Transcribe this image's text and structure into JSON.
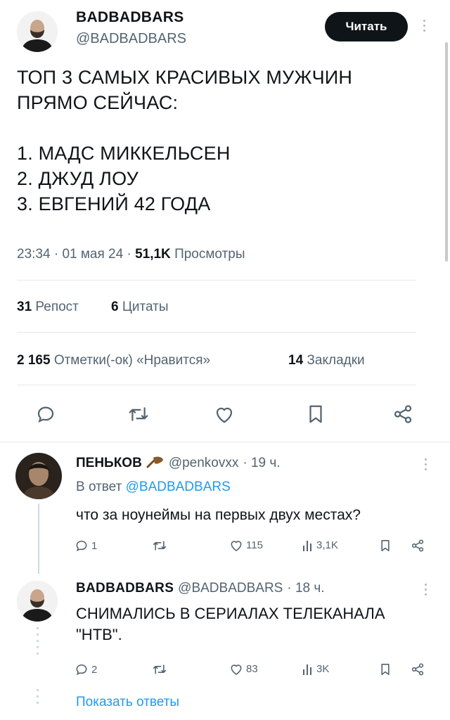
{
  "main_tweet": {
    "author_name": "BADBADBARS",
    "author_handle": "@BADBADBARS",
    "follow_label": "Читать",
    "text": "ТОП 3 САМЫХ КРАСИВЫХ МУЖЧИН\nПРЯМО СЕЙЧАС:\n\n1. МАДС МИККЕЛЬСЕН\n2. ДЖУД ЛОУ\n3. ЕВГЕНИЙ 42 ГОДА",
    "time": "23:34",
    "sep": "·",
    "date": "01 мая 24",
    "views_count": "51,1K",
    "views_label": "Просмотры",
    "reposts_count": "31",
    "reposts_label": "Репост",
    "quotes_count": "6",
    "quotes_label": "Цитаты",
    "likes_count": "2 165",
    "likes_label": "Отметки(-ок) «Нравится»",
    "bookmarks_count": "14",
    "bookmarks_label": "Закладки"
  },
  "reply1": {
    "author_name": "ПЕНЬКОВ",
    "author_handle": "@penkovxx",
    "time": "· 19 ч.",
    "reply_to_label": "В ответ",
    "reply_to_handle": "@BADBADBARS",
    "text": "что за ноунеймы на первых двух местах?",
    "replies": "1",
    "likes": "115",
    "views": "3,1K"
  },
  "reply2": {
    "author_name": "BADBADBARS",
    "author_handle": "@BADBADBARS",
    "time": "· 18 ч.",
    "text": "СНИМАЛИСЬ В СЕРИАЛАХ ТЕЛЕКАНАЛА\n\"НТВ\".",
    "replies": "2",
    "likes": "83",
    "views": "3K"
  },
  "show_replies_label": "Показать ответы"
}
